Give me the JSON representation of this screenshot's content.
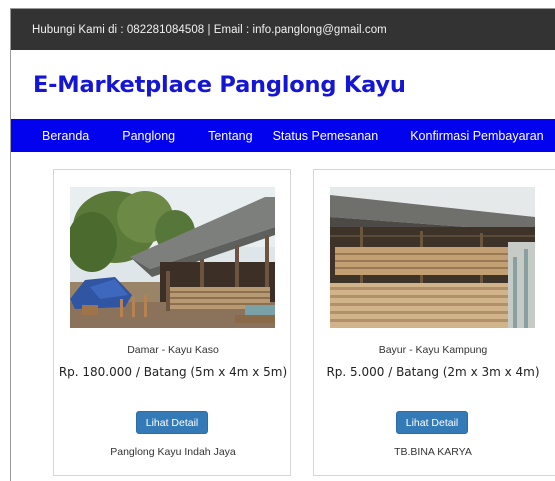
{
  "topbar": {
    "text": "Hubungi Kami di : 082281084508 | Email : info.panglong@gmail.com"
  },
  "brand": {
    "title": "E-Marketplace Panglong Kayu"
  },
  "nav": {
    "items": [
      {
        "label": "Beranda"
      },
      {
        "label": "Panglong"
      },
      {
        "label": "Tentang"
      },
      {
        "label": "Status Pemesanan"
      },
      {
        "label": "Konfirmasi Pembayaran"
      }
    ]
  },
  "products": [
    {
      "name": "Damar - Kayu Kaso",
      "price": "Rp. 180.000 / Batang (5m x 4m x 5m)",
      "button_label": "Lihat Detail",
      "seller": "Panglong Kayu Indah Jaya"
    },
    {
      "name": "Bayur - Kayu Kampung",
      "price": "Rp. 5.000 / Batang (2m x 3m x 4m)",
      "button_label": "Lihat Detail",
      "seller": "TB.BINA KARYA"
    }
  ],
  "colors": {
    "topbar_bg": "#333333",
    "brand_text": "#1515d6",
    "nav_bg": "#0202ee",
    "button_bg": "#337ab7"
  }
}
